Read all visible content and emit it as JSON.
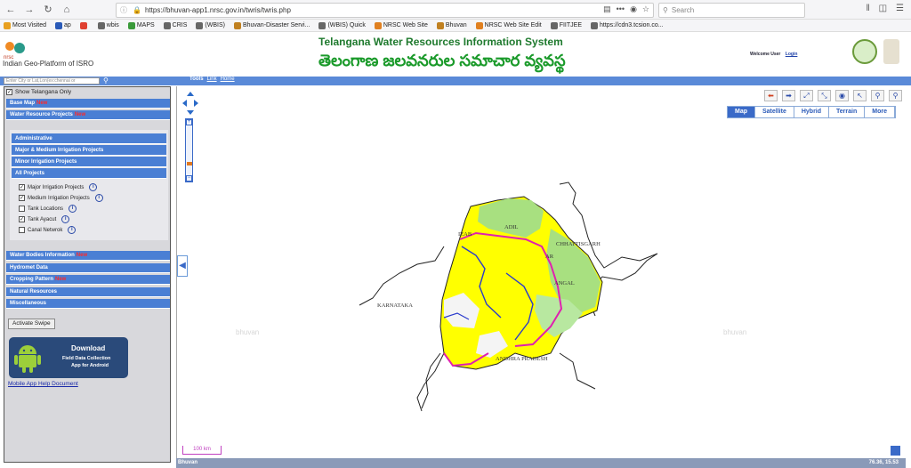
{
  "browser": {
    "url": "https://bhuvan-app1.nrsc.gov.in/twris/twris.php",
    "search_placeholder": "Search",
    "menu_dots": "•••"
  },
  "bookmarks": [
    {
      "label": "Most Visited",
      "color": "#e8a020"
    },
    {
      "label": "ap",
      "color": "#2a5ab8"
    },
    {
      "label": "",
      "color": "#e04030"
    },
    {
      "label": "wbis",
      "color": "#666666"
    },
    {
      "label": "MAPS",
      "color": "#3a9a3a"
    },
    {
      "label": "CRIS",
      "color": "#666666"
    },
    {
      "label": "(WBIS)",
      "color": "#666666"
    },
    {
      "label": "Bhuvan-Disaster Servi...",
      "color": "#c08020"
    },
    {
      "label": "(WBIS) Quick",
      "color": "#666666"
    },
    {
      "label": "NRSC Web Site",
      "color": "#e08020"
    },
    {
      "label": "Bhuvan",
      "color": "#c08020"
    },
    {
      "label": "NRSC Web Site Edit",
      "color": "#e08020"
    },
    {
      "label": "FIITJEE",
      "color": "#666666"
    },
    {
      "label": "https://cdn3.tcsion.co...",
      "color": "#666666"
    }
  ],
  "header": {
    "logo_text": "Indian Geo-Platform of ISRO",
    "title_en": "Telangana Water Resources Information System",
    "title_te": "తెలంగాణ జలవనరుల సమాచార వ్యవస్థ",
    "welcome": "Welcome User",
    "login": "Login"
  },
  "toolbar": {
    "location_placeholder": "Enter City or Lat,Lon(ex:chennai or",
    "tools": "Tools",
    "link": "Link",
    "home": "Home"
  },
  "sidebar": {
    "show_telangana": "Show Telangana Only",
    "base_map": "Base Map",
    "water_projects": "Water Resource Projects",
    "new_badge": "New",
    "subsections": [
      "Administrative",
      "Major & Medium Irrigation Projects",
      "Minor Irrigation Projects",
      "All Projects"
    ],
    "layers": [
      {
        "label": "Major Irrigation Projects",
        "checked": true
      },
      {
        "label": "Medium Irrigation Projects",
        "checked": true
      },
      {
        "label": "Tank Locations",
        "checked": false
      },
      {
        "label": "Tank Ayacut",
        "checked": true
      },
      {
        "label": "Canal Netwrok",
        "checked": false
      }
    ],
    "lower_sections": [
      {
        "label": "Water Bodies Information",
        "new": true
      },
      {
        "label": "Hydromet Data",
        "new": false
      },
      {
        "label": "Cropping Pattern",
        "new": true
      },
      {
        "label": "Natural Resources",
        "new": false
      },
      {
        "label": "Miscellaneous",
        "new": false
      }
    ],
    "activate_swipe": "Activate Swipe",
    "download": "Download",
    "download_sub1": "Field Data Collection",
    "download_sub2": "App for Android",
    "mobile_help": "Mobile App Help Document"
  },
  "map": {
    "map_types": [
      "Map",
      "Satellite",
      "Hybrid",
      "Terrain",
      "More"
    ],
    "active_type": "Map",
    "labels": {
      "chhattisgarh": "CHHATTISGARH",
      "karnataka": "KARNATAKA",
      "andhra": "ANDHRA PRADESH",
      "adilabad": "ADIL",
      "nizamabad": "IZAB",
      "warangal": "ANGAL",
      "karimnagar": "AR"
    },
    "watermark": "bhuvan",
    "scale": "100 km",
    "footer_label": "Bhuvan",
    "coords": "76.36, 15.53"
  }
}
